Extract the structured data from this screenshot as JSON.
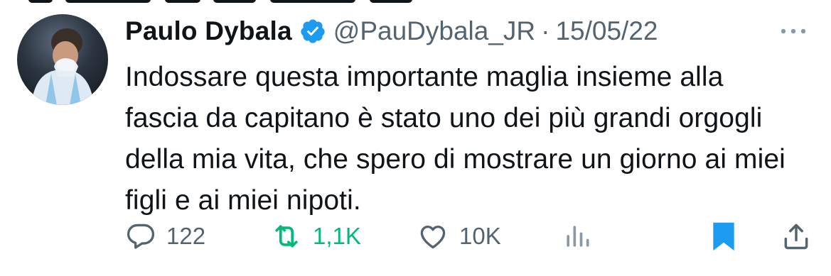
{
  "tweet": {
    "author_name": "Paulo Dybala",
    "handle": "@PauDybala_JR",
    "separator": "·",
    "date": "15/05/22",
    "text": "Indossare questa importante maglia insieme alla fascia da capitano è stato uno dei più grandi orgogli della mia vita, che spero di mostrare un giorno ai miei figli e ai miei nipoti."
  },
  "actions": {
    "replies": "122",
    "retweets": "1,1K",
    "likes": "10K"
  },
  "icons": {
    "verified": "verified-badge-icon",
    "more": "more-icon",
    "reply": "reply-icon",
    "retweet": "retweet-icon",
    "like": "heart-icon",
    "views": "views-icon",
    "bookmark": "bookmark-icon",
    "share": "share-icon"
  },
  "colors": {
    "verified": "#1d9bf0",
    "retweet_active": "#00ba7c",
    "bookmark_active": "#1d9bf0",
    "secondary_text": "#536471"
  }
}
